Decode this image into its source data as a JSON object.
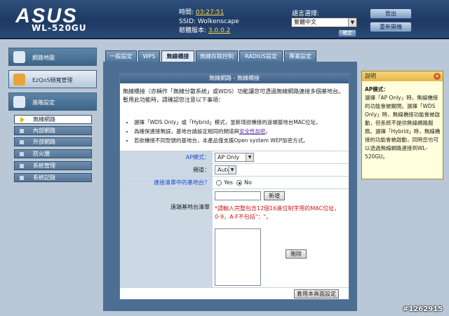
{
  "header": {
    "logo_text": "ASUS",
    "model": "WL-520GU",
    "time_label": "時間:",
    "time_value": "03:27:51",
    "ssid_label": "SSID:",
    "ssid_value": "Wolkenscape",
    "firmware_label": "韌體版本:",
    "firmware_value": "3.0.0.2",
    "language_label": "語言選擇:",
    "language_value": "繁體中文",
    "apply_label": "確定",
    "logout_label": "登出",
    "reboot_label": "重新開機"
  },
  "sidebar": {
    "items": [
      {
        "label": "網路地圖"
      },
      {
        "label": "EzQoS頻寬管理"
      },
      {
        "label": "進階設定"
      }
    ],
    "subitems": [
      {
        "label": "無線網路"
      },
      {
        "label": "內部網路"
      },
      {
        "label": "外部網路"
      },
      {
        "label": "防火牆"
      },
      {
        "label": "系統管理"
      },
      {
        "label": "系統記錄"
      }
    ]
  },
  "tabs": [
    {
      "label": "一般設定"
    },
    {
      "label": "WPS"
    },
    {
      "label": "無線橋接"
    },
    {
      "label": "無線存取控制"
    },
    {
      "label": "RADIUS設定"
    },
    {
      "label": "專業設定"
    }
  ],
  "panel": {
    "title": "無線網路 - 無線橋接",
    "description": "無線橋接（亦稱作「無線分散系統」或WDS）功能讓您可透過無線網路連接多個基地台。暫用此功能時，請確認您注意以下事項：",
    "bullet1": "選擇「WDS Only」或「Hybrid」模式，並新增欲橋接的遠端基地台MAC位址。",
    "bullet2_pre": "為確保連接無誤，基地台請設定相同的頻道與",
    "bullet2_link": "安全性加密",
    "bullet2_post": "。",
    "bullet3": "若欲橋接不同型號的基地台，本產品僅支援Open system WEP加密方式。",
    "ap_mode_label": "AP模式：",
    "ap_mode_value": "AP Only",
    "channel_label": "頻道：",
    "channel_value": "Auto",
    "connect_label": "連接清單中的基地台？",
    "yes_label": "Yes",
    "no_label": "No",
    "remote_list_label": "遠端基地台清單",
    "add_button": "新增",
    "hint_line1": "*請輸入完整包含12個16進位制字用的MAC位址，",
    "hint_line2": "0-9，A-F不包括\"：\"。",
    "delete_button": "刪除",
    "apply_button": "套用本頁面設定"
  },
  "help": {
    "title": "說明",
    "heading": "AP模式：",
    "text": "選擇「AP Only」時，無線橋接的功能會被關閉。選擇「WDS Only」時，無線橋接功能會被啟動，但系統不提供無線網路服務。選擇「Hybrid」時，無線橋接的功能會被啟動，同時您也可以透過無線網路連接到WL-520GU。"
  },
  "watermark": "#1262915"
}
